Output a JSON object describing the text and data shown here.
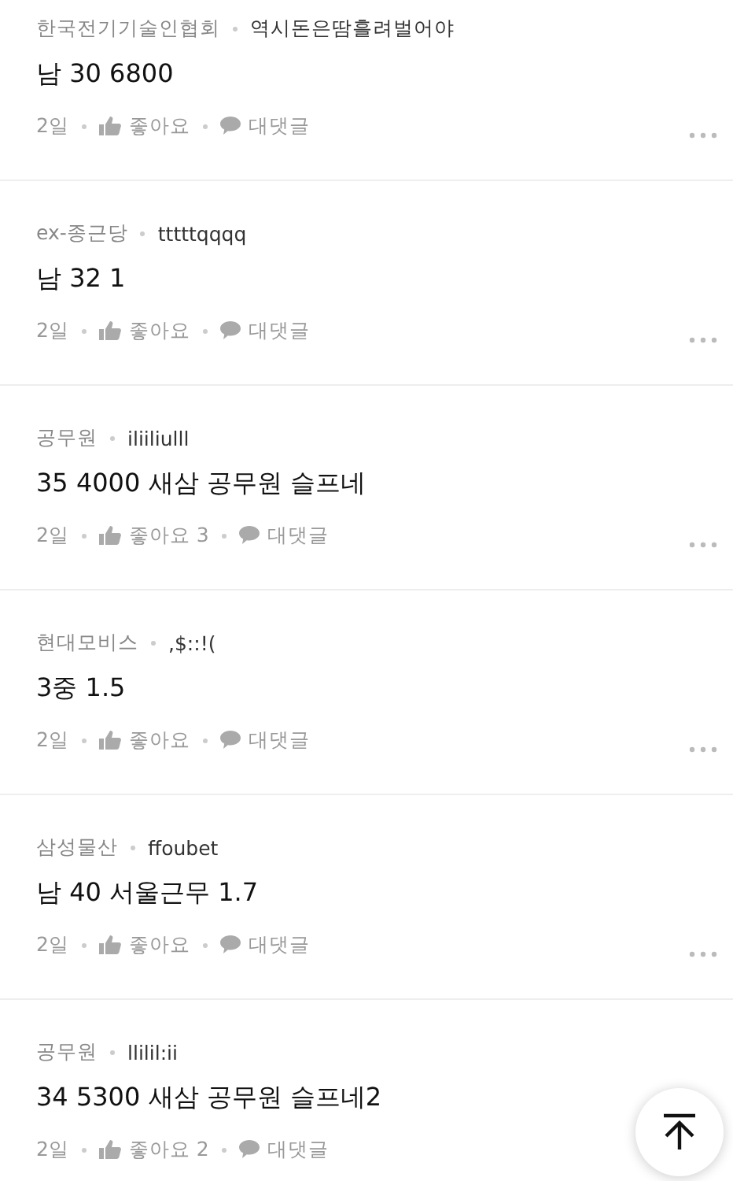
{
  "comments": [
    {
      "company": "한국전기기술인협회",
      "nickname": "역시돈은땀흘려벌어야",
      "body": "남 30 6800",
      "time": "2일",
      "like": "좋아요",
      "reply": "대댓글"
    },
    {
      "company": "ex-종근당",
      "nickname": "tttttqqqq",
      "body": "남 32 1",
      "time": "2일",
      "like": "좋아요",
      "reply": "대댓글"
    },
    {
      "company": "공무원",
      "nickname": "iliiliulll",
      "body": "35 4000 새삼 공무원 슬프네",
      "time": "2일",
      "like": "좋아요 3",
      "reply": "대댓글"
    },
    {
      "company": "현대모비스",
      "nickname": ",$::!(",
      "body": "3중 1.5",
      "time": "2일",
      "like": "좋아요",
      "reply": "대댓글"
    },
    {
      "company": "삼성물산",
      "nickname": "ffoubet",
      "body": "남 40 서울근무 1.7",
      "time": "2일",
      "like": "좋아요",
      "reply": "대댓글"
    },
    {
      "company": "공무원",
      "nickname": "llilil:ii",
      "body": "34 5300 새삼 공무원 슬프네2",
      "time": "2일",
      "like": "좋아요 2",
      "reply": "대댓글"
    }
  ]
}
